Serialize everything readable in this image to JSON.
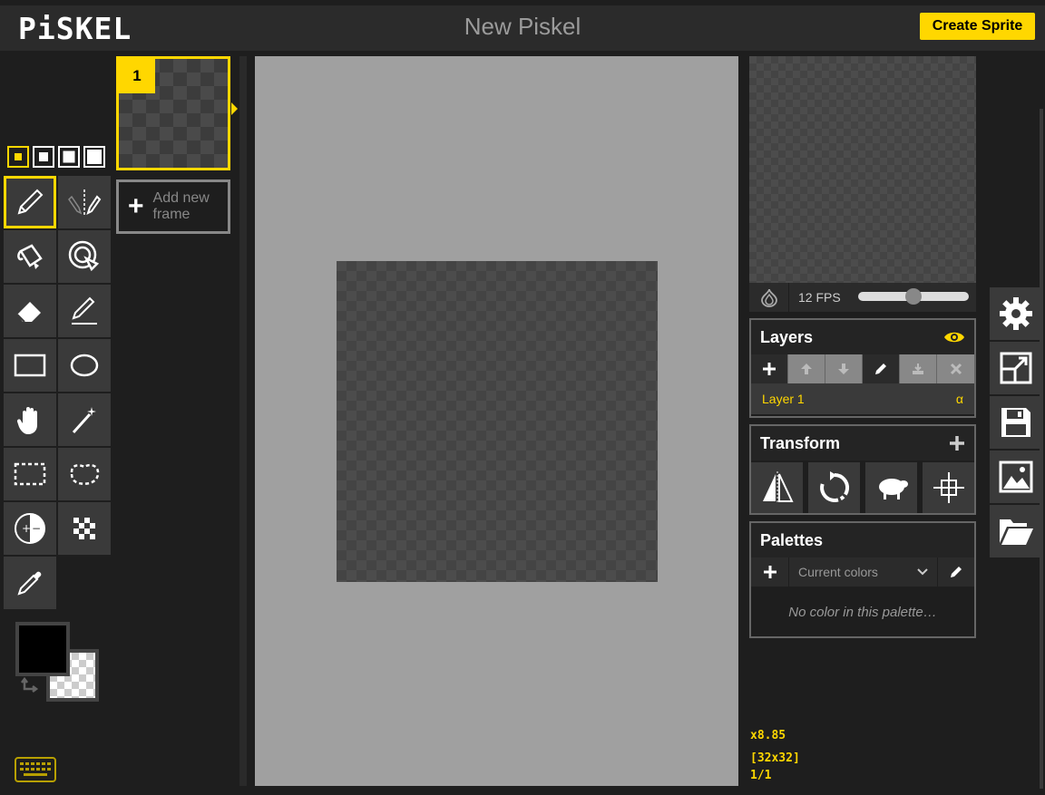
{
  "header": {
    "logo": "PiSKEL",
    "title": "New Piskel",
    "create_label": "Create Sprite"
  },
  "tools": {
    "pen_sizes": [
      "1",
      "2",
      "3",
      "4"
    ],
    "items": [
      "pen-icon",
      "vertical-mirror-pen-icon",
      "paint-bucket-icon",
      "paint-all-same-color-icon",
      "eraser-icon",
      "stroke-icon",
      "rectangle-icon",
      "circle-icon",
      "move-icon",
      "magic-wand-icon",
      "rectangle-select-icon",
      "lasso-select-icon",
      "lighten-darken-icon",
      "dithering-icon",
      "color-picker-icon"
    ]
  },
  "frames": {
    "current_number": "1",
    "add_label": "Add new frame"
  },
  "preview": {
    "fps_label": "12 FPS",
    "fps_value": 12
  },
  "layers": {
    "title": "Layers",
    "layer_name": "Layer 1",
    "alpha_symbol": "α"
  },
  "transform": {
    "title": "Transform"
  },
  "palettes": {
    "title": "Palettes",
    "selected": "Current colors",
    "empty_message": "No color in this palette…"
  },
  "status": {
    "zoom": "x8.85",
    "size": "[32x32]",
    "frame_index": "1/1"
  },
  "colors": {
    "accent": "#ffd700",
    "primary": "#000000",
    "secondary": "transparent"
  }
}
